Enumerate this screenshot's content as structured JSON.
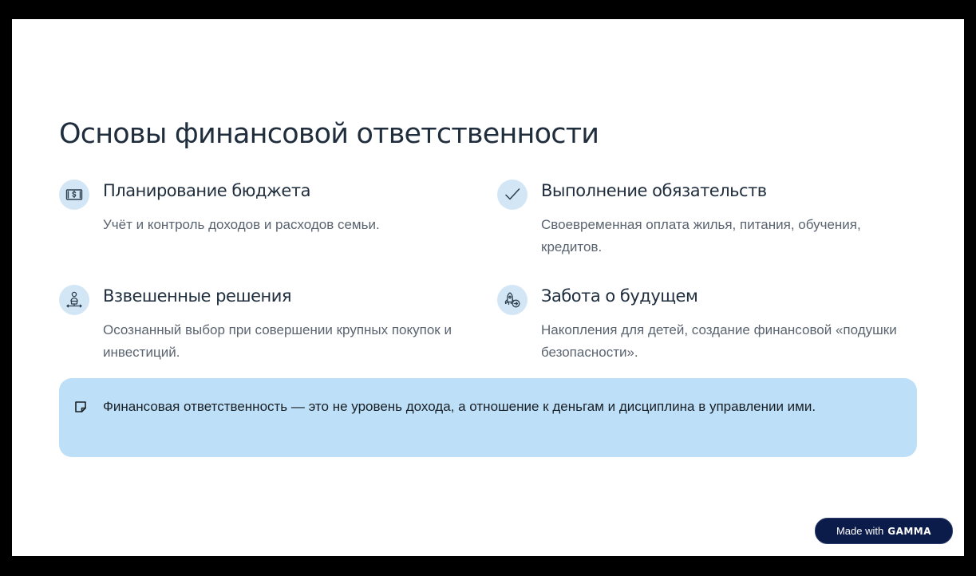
{
  "slide": {
    "title": "Основы финансовой ответственности"
  },
  "features": [
    {
      "title": "Планирование бюджета",
      "description": "Учёт и контроль доходов и расходов семьи.",
      "icon": "money-bill-icon"
    },
    {
      "title": "Выполнение обязательств",
      "description": "Своевременная оплата жилья, питания, обучения, кредитов.",
      "icon": "checkmark-icon"
    },
    {
      "title": "Взвешенные решения",
      "description": "Осознанный выбор при совершении крупных покупок и инвестиций.",
      "icon": "decision-person-icon"
    },
    {
      "title": "Забота о будущем",
      "description": "Накопления для детей, создание финансовой «подушки безопасности».",
      "icon": "rocket-icon"
    }
  ],
  "callout": {
    "text": "Финансовая ответственность — это не уровень дохода, а отношение к деньгам и дисциплина в управлении ими.",
    "icon": "note-icon"
  },
  "badge": {
    "prefix": "Made with",
    "brand": "GAMMA"
  },
  "colors": {
    "title": "#1f2d3d",
    "description": "#5a6470",
    "icon_circle": "#d3e6f6",
    "icon_stroke": "#2c3e50",
    "callout_bg": "#bde0f8",
    "badge_bg": "#0c1c4a"
  }
}
